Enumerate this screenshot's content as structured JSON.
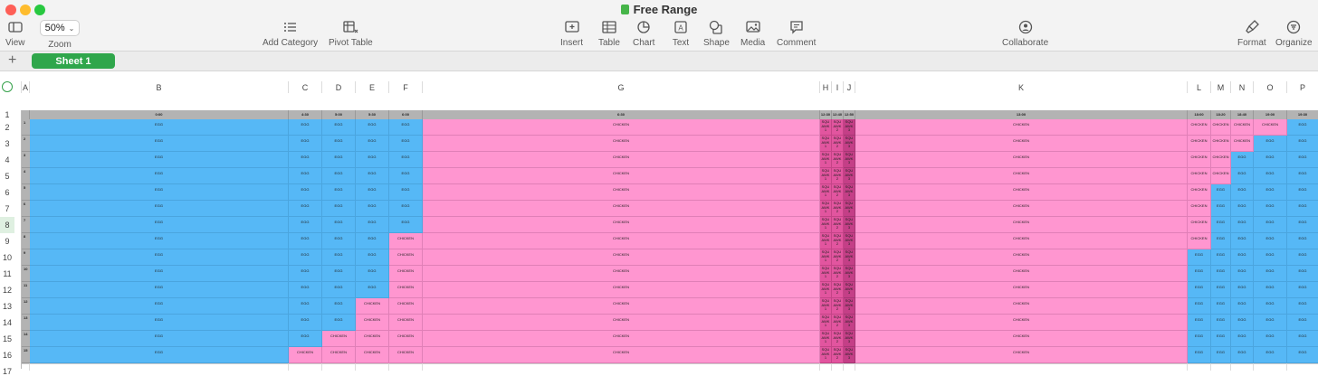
{
  "window": {
    "title": "Free Range"
  },
  "toolbar": {
    "view_label": "View",
    "zoom_value": "50%",
    "zoom_label": "Zoom",
    "add_category_label": "Add Category",
    "pivot_table_label": "Pivot Table",
    "insert_label": "Insert",
    "table_label": "Table",
    "chart_label": "Chart",
    "text_label": "Text",
    "shape_label": "Shape",
    "media_label": "Media",
    "comment_label": "Comment",
    "collaborate_label": "Collaborate",
    "format_label": "Format",
    "organize_label": "Organize"
  },
  "sheets": {
    "add": "+",
    "active": "Sheet 1"
  },
  "columns": [
    "A",
    "B",
    "C",
    "D",
    "E",
    "F",
    "G",
    "H",
    "I",
    "J",
    "K",
    "L",
    "M",
    "N",
    "O",
    "P"
  ],
  "rows": [
    "1",
    "2",
    "3",
    "4",
    "5",
    "6",
    "7",
    "8",
    "9",
    "10",
    "11",
    "12",
    "13",
    "14",
    "15",
    "16",
    "17"
  ],
  "times": [
    "0:00",
    "4:30",
    "5:00",
    "5:30",
    "6:00",
    "6:30",
    "12:30",
    "12:40",
    "12:50",
    "13:00",
    "18:00",
    "18:20",
    "18:40",
    "19:00",
    "19:30"
  ],
  "row_numbers": [
    "1",
    "2",
    "3",
    "4",
    "5",
    "6",
    "7",
    "8",
    "9",
    "10",
    "11",
    "12",
    "13",
    "14",
    "15"
  ],
  "words": {
    "egg": "EGG",
    "chicken": "CHICKEN",
    "squawk_1": "SQU AWK 1",
    "squawk_2": "SQU AWK 2",
    "squawk_3": "SQU AWK 3"
  },
  "colors": {
    "egg": "#56b8f6",
    "chicken": "#ff96d0",
    "squawk_1": "#e2559f",
    "squawk_2": "#e2559f",
    "squawk_3": "#c43f87",
    "header": "#b3b3b3",
    "accent": "#2fa64b"
  },
  "grid": [
    [
      "egg",
      "egg",
      "egg",
      "egg",
      "egg",
      "chicken",
      "squawk_1",
      "squawk_2",
      "squawk_3",
      "chicken",
      "chicken",
      "chicken",
      "chicken",
      "chicken",
      "egg"
    ],
    [
      "egg",
      "egg",
      "egg",
      "egg",
      "egg",
      "chicken",
      "squawk_1",
      "squawk_2",
      "squawk_3",
      "chicken",
      "chicken",
      "chicken",
      "chicken",
      "egg",
      "egg"
    ],
    [
      "egg",
      "egg",
      "egg",
      "egg",
      "egg",
      "chicken",
      "squawk_1",
      "squawk_2",
      "squawk_3",
      "chicken",
      "chicken",
      "chicken",
      "egg",
      "egg",
      "egg"
    ],
    [
      "egg",
      "egg",
      "egg",
      "egg",
      "egg",
      "chicken",
      "squawk_1",
      "squawk_2",
      "squawk_3",
      "chicken",
      "chicken",
      "chicken",
      "egg",
      "egg",
      "egg"
    ],
    [
      "egg",
      "egg",
      "egg",
      "egg",
      "egg",
      "chicken",
      "squawk_1",
      "squawk_2",
      "squawk_3",
      "chicken",
      "chicken",
      "egg",
      "egg",
      "egg",
      "egg"
    ],
    [
      "egg",
      "egg",
      "egg",
      "egg",
      "egg",
      "chicken",
      "squawk_1",
      "squawk_2",
      "squawk_3",
      "chicken",
      "chicken",
      "egg",
      "egg",
      "egg",
      "egg"
    ],
    [
      "egg",
      "egg",
      "egg",
      "egg",
      "egg",
      "chicken",
      "squawk_1",
      "squawk_2",
      "squawk_3",
      "chicken",
      "chicken",
      "egg",
      "egg",
      "egg",
      "egg"
    ],
    [
      "egg",
      "egg",
      "egg",
      "egg",
      "chicken",
      "chicken",
      "squawk_1",
      "squawk_2",
      "squawk_3",
      "chicken",
      "chicken",
      "egg",
      "egg",
      "egg",
      "egg"
    ],
    [
      "egg",
      "egg",
      "egg",
      "egg",
      "chicken",
      "chicken",
      "squawk_1",
      "squawk_2",
      "squawk_3",
      "chicken",
      "egg",
      "egg",
      "egg",
      "egg",
      "egg"
    ],
    [
      "egg",
      "egg",
      "egg",
      "egg",
      "chicken",
      "chicken",
      "squawk_1",
      "squawk_2",
      "squawk_3",
      "chicken",
      "egg",
      "egg",
      "egg",
      "egg",
      "egg"
    ],
    [
      "egg",
      "egg",
      "egg",
      "egg",
      "chicken",
      "chicken",
      "squawk_1",
      "squawk_2",
      "squawk_3",
      "chicken",
      "egg",
      "egg",
      "egg",
      "egg",
      "egg"
    ],
    [
      "egg",
      "egg",
      "egg",
      "chicken",
      "chicken",
      "chicken",
      "squawk_1",
      "squawk_2",
      "squawk_3",
      "chicken",
      "egg",
      "egg",
      "egg",
      "egg",
      "egg"
    ],
    [
      "egg",
      "egg",
      "egg",
      "chicken",
      "chicken",
      "chicken",
      "squawk_1",
      "squawk_2",
      "squawk_3",
      "chicken",
      "egg",
      "egg",
      "egg",
      "egg",
      "egg"
    ],
    [
      "egg",
      "egg",
      "chicken",
      "chicken",
      "chicken",
      "chicken",
      "squawk_1",
      "squawk_2",
      "squawk_3",
      "chicken",
      "egg",
      "egg",
      "egg",
      "egg",
      "egg"
    ],
    [
      "egg",
      "chicken",
      "chicken",
      "chicken",
      "chicken",
      "chicken",
      "squawk_1",
      "squawk_2",
      "squawk_3",
      "chicken",
      "egg",
      "egg",
      "egg",
      "egg",
      "egg"
    ]
  ]
}
